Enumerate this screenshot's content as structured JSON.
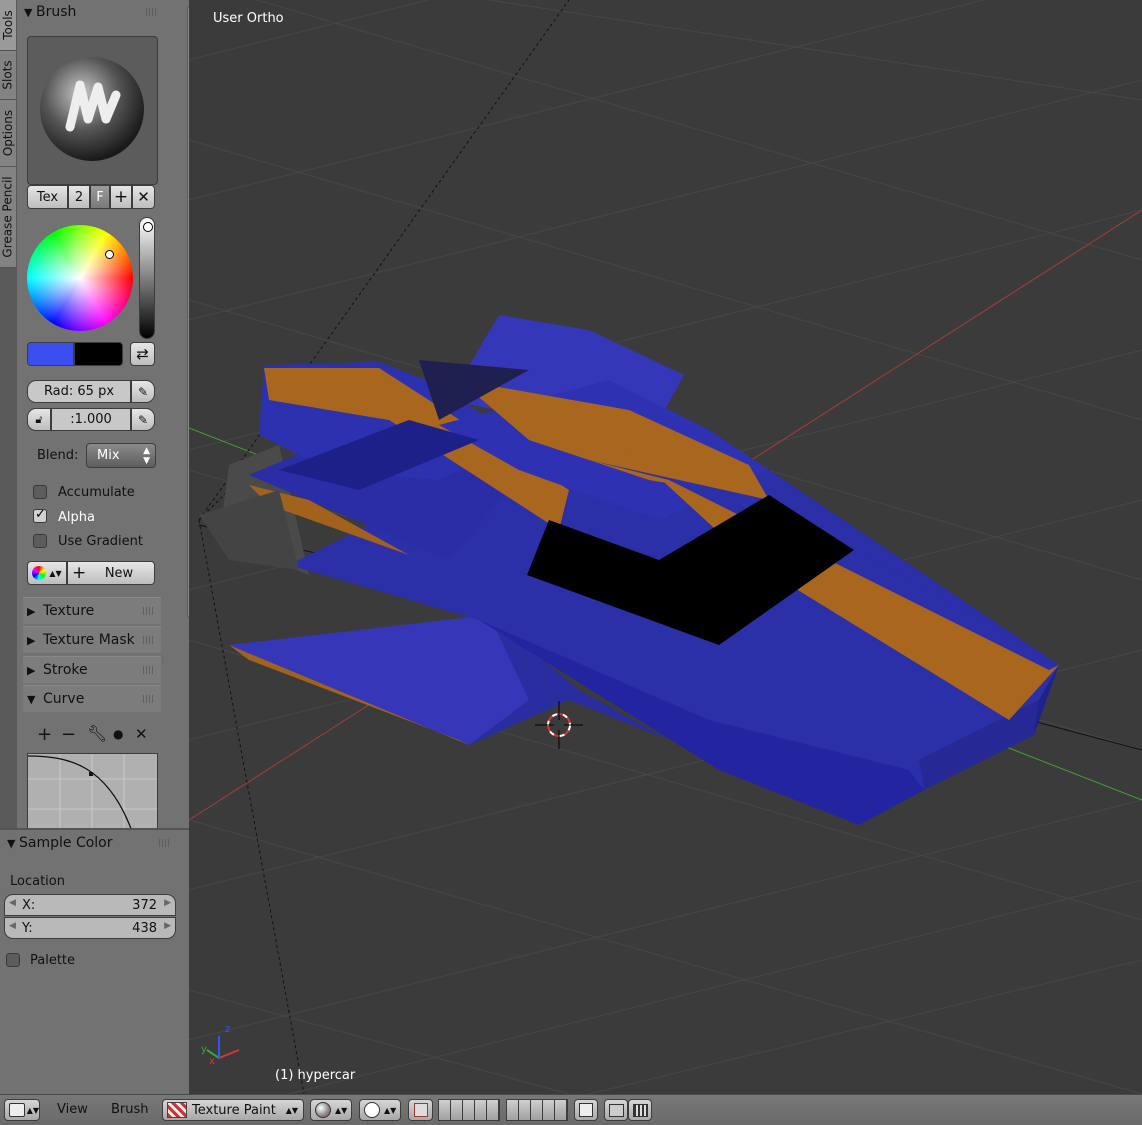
{
  "viewport": {
    "view_name": "User Ortho",
    "object_label": "(1) hypercar",
    "axis_labels": {
      "x": "x",
      "y": "y",
      "z": "z"
    }
  },
  "side_tabs": [
    "Tools",
    "Slots",
    "Options",
    "Grease Pencil"
  ],
  "brush": {
    "header": "Brush",
    "tex_label": "Tex",
    "users_count": "2",
    "fake_user": "F",
    "radius": "Rad: 65 px",
    "strength": ":1.000",
    "blend_label": "Blend:",
    "blend_value": "Mix",
    "primary_color": "#3b4ef0",
    "secondary_color": "#000000",
    "options": [
      {
        "label": "Accumulate",
        "checked": false
      },
      {
        "label": "Alpha",
        "checked": true
      },
      {
        "label": "Use Gradient",
        "checked": false
      }
    ],
    "new_label": "New"
  },
  "subpanels": {
    "texture": "Texture",
    "texture_mask": "Texture Mask",
    "stroke": "Stroke",
    "curve": "Curve"
  },
  "sample_color": {
    "header": "Sample Color",
    "location_label": "Location",
    "x_label": "X:",
    "x_value": "372",
    "y_label": "Y:",
    "y_value": "438",
    "palette_label": "Palette"
  },
  "bottom_bar": {
    "menu_view": "View",
    "menu_brush": "Brush",
    "mode": "Texture Paint"
  },
  "colors": {
    "viewport_bg": "#3b3b3b",
    "panel_bg": "#727272",
    "model_blue": "#2b2fa8",
    "stripe_orange": "#a8661e"
  }
}
